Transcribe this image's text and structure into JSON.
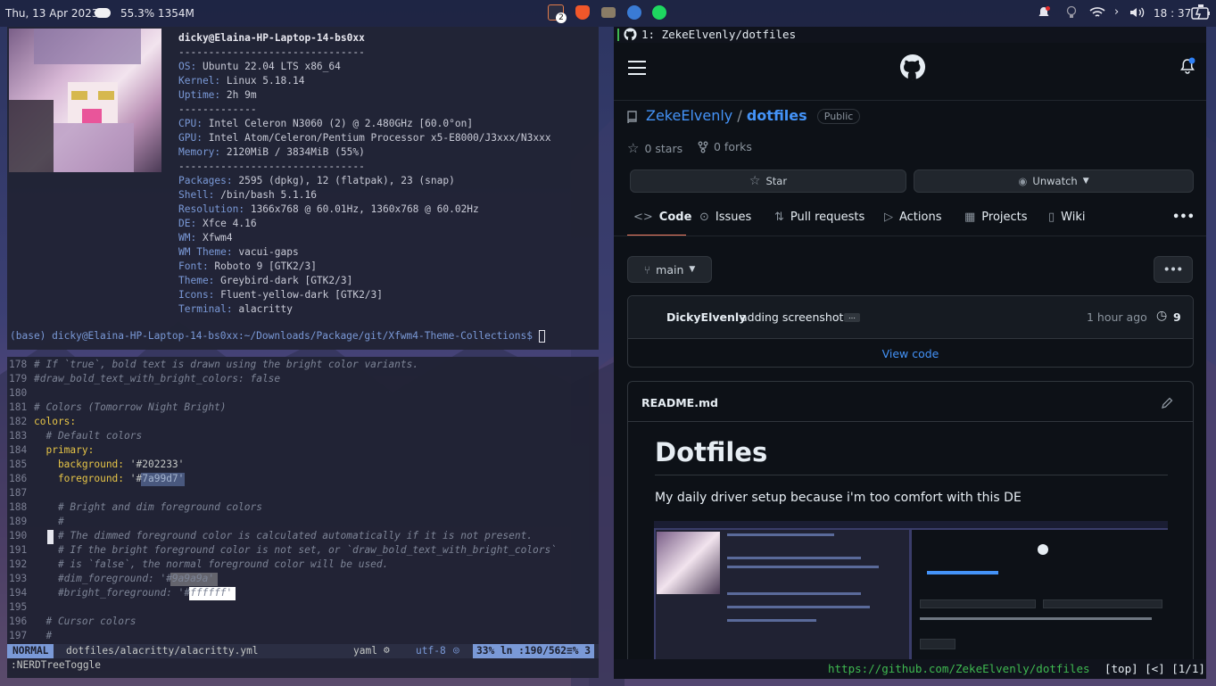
{
  "topbar": {
    "datetime": "Thu, 13 Apr 2023",
    "cpu_mem": "55.3% 1354M",
    "notif_badge": "2",
    "clock": "18 : 37",
    "icons": [
      "weather-cloud-icon",
      "notes-app-icon",
      "brave-browser-icon",
      "folder-icon",
      "thunderbird-icon",
      "spotify-icon",
      "bell-icon",
      "lightbulb-icon",
      "wifi-icon",
      "chevron-right-icon",
      "volume-icon",
      "battery-icon"
    ]
  },
  "neofetch": {
    "user_host": "dicky@Elaina-HP-Laptop-14-bs0xx",
    "sep1": "-------------------------------",
    "os": {
      "k": "OS:",
      "v": " Ubuntu 22.04 LTS x86_64"
    },
    "kernel": {
      "k": "Kernel:",
      "v": " Linux 5.18.14"
    },
    "uptime": {
      "k": "Uptime:",
      "v": " 2h 9m"
    },
    "sep2": "-------------",
    "cpu": {
      "k": "CPU:",
      "v": " Intel Celeron N3060 (2) @ 2.480GHz [60.0°on]"
    },
    "gpu": {
      "k": "GPU:",
      "v": " Intel Atom/Celeron/Pentium Processor x5-E8000/J3xxx/N3xxx"
    },
    "memory": {
      "k": "Memory:",
      "v": " 2120MiB / 3834MiB (55%)"
    },
    "sep3": "-------------------------------",
    "packages": {
      "k": "Packages:",
      "v": " 2595 (dpkg), 12 (flatpak), 23 (snap)"
    },
    "shell": {
      "k": "Shell:",
      "v": " /bin/bash 5.1.16"
    },
    "resolution": {
      "k": "Resolution:",
      "v": " 1366x768 @ 60.01Hz, 1360x768 @ 60.02Hz"
    },
    "de": {
      "k": "DE:",
      "v": " Xfce 4.16"
    },
    "wm": {
      "k": "WM:",
      "v": " Xfwm4"
    },
    "wm_theme": {
      "k": "WM Theme:",
      "v": " vacui-gaps"
    },
    "font": {
      "k": "Font:",
      "v": " Roboto 9 [GTK2/3]"
    },
    "theme": {
      "k": "Theme:",
      "v": " Greybird-dark [GTK2/3]"
    },
    "icons": {
      "k": "Icons:",
      "v": " Fluent-yellow-dark [GTK2/3]"
    },
    "terminal": {
      "k": "Terminal:",
      "v": " alacritty"
    },
    "prompt": "(base) dicky@Elaina-HP-Laptop-14-bs0xx:~/Downloads/Package/git/Xfwm4-Theme-Collections$ "
  },
  "vim": {
    "lines": [
      {
        "n": "178",
        "t": "# If `true`, bold text is drawn using the bright color variants."
      },
      {
        "n": "179",
        "t": "#draw_bold_text_with_bright_colors: false"
      },
      {
        "n": "180",
        "t": ""
      },
      {
        "n": "181",
        "t": "# Colors (Tomorrow Night Bright)"
      },
      {
        "n": "182",
        "k": "colors:"
      },
      {
        "n": "183",
        "t": "  # Default colors"
      },
      {
        "n": "184",
        "k": "  primary:"
      },
      {
        "n": "185",
        "k": "    background:",
        "v": " '#202233'"
      },
      {
        "n": "186",
        "k": "    foreground:",
        "v": " '#7a99d7'"
      },
      {
        "n": "187",
        "t": ""
      },
      {
        "n": "188",
        "t": "    # Bright and dim foreground colors"
      },
      {
        "n": "189",
        "t": "    #"
      },
      {
        "n": "190",
        "t": "    # The dimmed foreground color is calculated automatically if it is not present."
      },
      {
        "n": "191",
        "t": "    # If the bright foreground color is not set, or `draw_bold_text_with_bright_colors`"
      },
      {
        "n": "192",
        "t": "    # is `false`, the normal foreground color will be used."
      },
      {
        "n": "193",
        "t": "    #dim_foreground: '#9a9a9a'"
      },
      {
        "n": "194",
        "t": "    #bright_foreground: '#ffffff'"
      },
      {
        "n": "195",
        "t": ""
      },
      {
        "n": "196",
        "t": "  # Cursor colors"
      },
      {
        "n": "197",
        "t": "  #"
      }
    ],
    "mode": "NORMAL",
    "file": "dotfiles/alacritty/alacritty.yml",
    "filetype": "yaml",
    "encoding": "utf-8",
    "position": "33% ln :190/562≡% 3",
    "cmdline": ":NERDTreeToggle"
  },
  "browser": {
    "tab_title": "1: ZekeElvenly/dotfiles",
    "owner": "ZekeElvenly",
    "slash": "/",
    "repo": "dotfiles",
    "visibility": "Public",
    "stars": "0 stars",
    "forks": "0 forks",
    "star_btn": "Star",
    "unwatch_btn": "Unwatch",
    "tabs": [
      "Code",
      "Issues",
      "Pull requests",
      "Actions",
      "Projects",
      "Wiki"
    ],
    "more": "•••",
    "branch": "main",
    "commit_author": "DickyElvenly",
    "commit_msg": "adding screenshot",
    "commit_time": "1 hour ago",
    "commit_count": "9",
    "view_code": "View code",
    "readme_file": "README.md",
    "readme_h1": "Dotfiles",
    "readme_p": "My daily driver setup because i'm too comfort with this DE",
    "url": "https://github.com/ZekeElvenly/dotfiles",
    "status": "[top] [<] [1/1]"
  }
}
